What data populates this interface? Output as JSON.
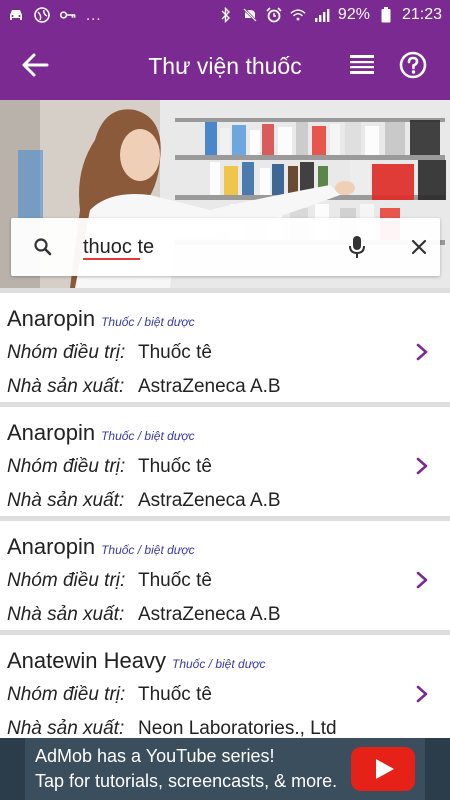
{
  "status_bar": {
    "left_icons": [
      "car-icon",
      "globe-icon",
      "key-icon"
    ],
    "overflow": "...",
    "right_icons": [
      "bluetooth-icon",
      "mute-icon",
      "alarm-icon",
      "wifi-icon",
      "signal-icon"
    ],
    "battery_percent": "92%",
    "time": "21:23"
  },
  "app_bar": {
    "title": "Thư viện thuốc",
    "back_icon": "arrow-left-icon",
    "list_icon": "list-view-icon",
    "help_icon": "help-circle-icon",
    "color": "#7b2a92"
  },
  "search": {
    "value": "thuoc te",
    "search_icon": "search-icon",
    "mic_icon": "mic-icon",
    "clear_icon": "close-icon"
  },
  "results": [
    {
      "name": "Anaropin",
      "type": "Thuốc / biệt dược",
      "group_label": "Nhóm điều trị:",
      "group": "Thuốc tê",
      "maker_label": "Nhà sản xuất:",
      "maker": "AstraZeneca A.B"
    },
    {
      "name": "Anaropin",
      "type": "Thuốc / biệt dược",
      "group_label": "Nhóm điều trị:",
      "group": "Thuốc tê",
      "maker_label": "Nhà sản xuất:",
      "maker": "AstraZeneca A.B"
    },
    {
      "name": "Anaropin",
      "type": "Thuốc / biệt dược",
      "group_label": "Nhóm điều trị:",
      "group": "Thuốc tê",
      "maker_label": "Nhà sản xuất:",
      "maker": "AstraZeneca A.B"
    },
    {
      "name": "Anatewin Heavy",
      "type": "Thuốc / biệt dược",
      "group_label": "Nhóm điều trị:",
      "group": "Thuốc tê",
      "maker_label": "Nhà sản xuất:",
      "maker": "Neon Laboratories., Ltd"
    }
  ],
  "ad": {
    "line1": "AdMob has a YouTube series!",
    "line2": "Tap for tutorials, screencasts, & more.",
    "icon": "youtube-play-icon"
  }
}
